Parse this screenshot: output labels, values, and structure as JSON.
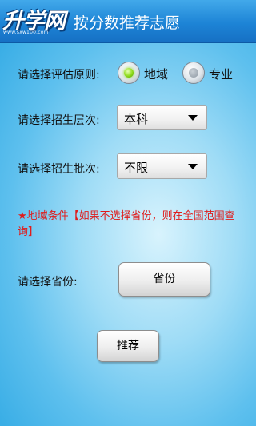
{
  "header": {
    "logo_text": "升学网",
    "logo_url": "www.sxw100.com",
    "title": "按分数推荐志愿"
  },
  "form": {
    "principle": {
      "label": "请选择评估原则:",
      "options": [
        {
          "label": "地域",
          "checked": true
        },
        {
          "label": "专业",
          "checked": false
        }
      ]
    },
    "level": {
      "label": "请选择招生层次:",
      "value": "本科"
    },
    "batch": {
      "label": "请选择招生批次:",
      "value": "不限"
    },
    "notice": "★地域条件【如果不选择省份，则在全国范围查询】",
    "province": {
      "label": "请选择省份:",
      "button_label": "省份"
    },
    "submit_label": "推荐"
  },
  "colors": {
    "titlebar": "#1d84d6",
    "background": "#5ec0ee",
    "notice": "#e01b1b",
    "radio_checked": "#8fdc1a"
  },
  "icons": [
    "radio-checked-icon",
    "radio-unchecked-icon",
    "dropdown-caret-icon"
  ]
}
